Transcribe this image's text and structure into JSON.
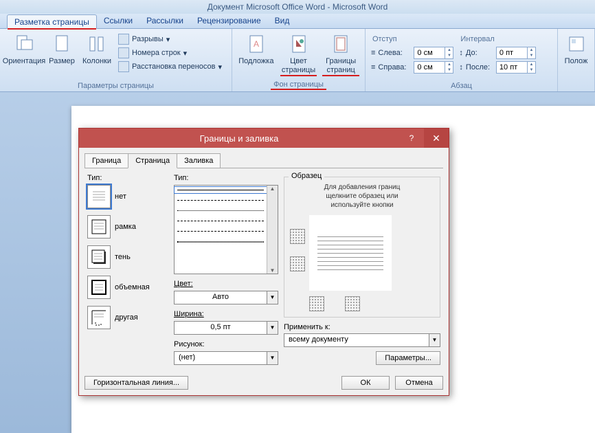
{
  "titlebar": "Документ Microsoft Office Word - Microsoft Word",
  "tabs": {
    "active": "Разметка страницы",
    "links": "Ссылки",
    "mailings": "Рассылки",
    "review": "Рецензирование",
    "view": "Вид"
  },
  "ribbon": {
    "pageSetup": {
      "orientation": "Ориентация",
      "size": "Размер",
      "columns": "Колонки",
      "breaks": "Разрывы",
      "lineNumbers": "Номера строк",
      "hyphenation": "Расстановка переносов",
      "label": "Параметры страницы"
    },
    "pageBg": {
      "watermark": "Подложка",
      "pageColor": "Цвет страницы",
      "pageBorders": "Границы страниц",
      "label": "Фон страницы"
    },
    "indent": {
      "head": "Отступ",
      "left": "Слева:",
      "right": "Справа:",
      "leftVal": "0 см",
      "rightVal": "0 см"
    },
    "spacing": {
      "head": "Интервал",
      "before": "До:",
      "after": "После:",
      "beforeVal": "0 пт",
      "afterVal": "10 пт"
    },
    "paragraph": "Абзац",
    "position": "Полож"
  },
  "dialog": {
    "title": "Границы и заливка",
    "help": "?",
    "close": "✕",
    "tabs": {
      "borders": "Граница",
      "page": "Страница",
      "fill": "Заливка"
    },
    "typeLbl": "Тип:",
    "types": {
      "none": "нет",
      "box": "рамка",
      "shadow": "тень",
      "threeD": "объемная",
      "custom": "другая"
    },
    "styleLbl": "Тип:",
    "colorLbl": "Цвет:",
    "colorVal": "Авто",
    "widthLbl": "Ширина:",
    "widthVal": "0,5 пт",
    "artLbl": "Рисунок:",
    "artVal": "(нет)",
    "previewLbl": "Образец",
    "hint1": "Для добавления границ",
    "hint2": "щелкните образец или",
    "hint3": "используйте кнопки",
    "applyLbl": "Применить к:",
    "applyVal": "всему документу",
    "params": "Параметры...",
    "hline": "Горизонтальная линия...",
    "ok": "ОК",
    "cancel": "Отмена"
  }
}
